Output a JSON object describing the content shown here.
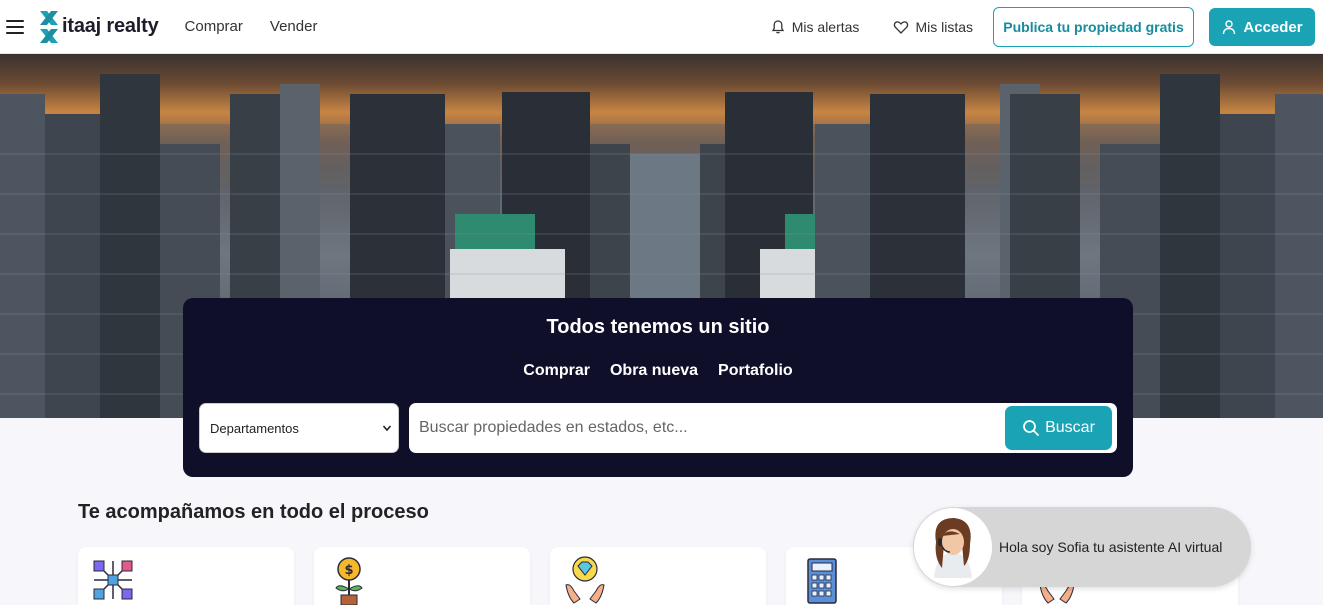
{
  "header": {
    "logo_text": "itaaj realty",
    "nav": [
      "Comprar",
      "Vender"
    ],
    "alerts_label": "Mis alertas",
    "lists_label": "Mis listas",
    "publish_label": "Publica tu propiedad gratis",
    "login_label": "Acceder"
  },
  "search": {
    "title": "Todos tenemos un sitio",
    "tabs": [
      "Comprar",
      "Obra nueva",
      "Portafolio"
    ],
    "property_type": "Departamentos",
    "placeholder": "Buscar propiedades en estados, etc...",
    "button_label": "Buscar"
  },
  "section": {
    "title": "Te acompañamos en todo el proceso",
    "cards": [
      {
        "icon": "network-cubes-icon"
      },
      {
        "icon": "money-plant-icon"
      },
      {
        "icon": "diamond-hands-icon"
      },
      {
        "icon": "calculator-icon"
      },
      {
        "icon": "hands-icon"
      }
    ]
  },
  "chat": {
    "message": "Hola soy Sofia tu asistente AI virtual"
  },
  "colors": {
    "accent": "#1aa3b5",
    "panel": "#0f0f2a",
    "page_bg": "#f6f6fb"
  }
}
